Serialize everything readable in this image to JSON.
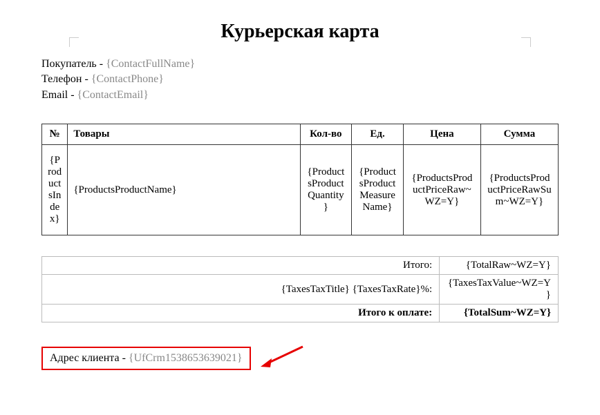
{
  "title": "Курьерская карта",
  "contact": {
    "buyer_label": "Покупатель",
    "buyer_value": "{ContactFullName}",
    "phone_label": "Телефон",
    "phone_value": "{ContactPhone}",
    "email_label": "Email",
    "email_value": "{ContactEmail}"
  },
  "table": {
    "headers": {
      "num": "№",
      "products": "Товары",
      "qty": "Кол-во",
      "unit": "Ед.",
      "price": "Цена",
      "sum": "Сумма"
    },
    "row": {
      "num": "{ProductsIndex}",
      "name": "{ProductsProductName}",
      "qty": "{ProductsProductQuantity}",
      "unit": "{ProductsProductMeasureName}",
      "price": "{ProductsProductPriceRaw~WZ=Y}",
      "sum": "{ProductsProductPriceRawSum~WZ=Y}"
    }
  },
  "summary": {
    "total_label": "Итого:",
    "total_value": "{TotalRaw~WZ=Y}",
    "taxes_label": "{TaxesTaxTitle} {TaxesTaxRate}%:",
    "taxes_value": "{TaxesTaxValue~WZ=Y}",
    "final_label": "Итого к оплате:",
    "final_value": "{TotalSum~WZ=Y}"
  },
  "address": {
    "label": "Адрес клиента",
    "value": "{UfCrm1538653639021}"
  }
}
